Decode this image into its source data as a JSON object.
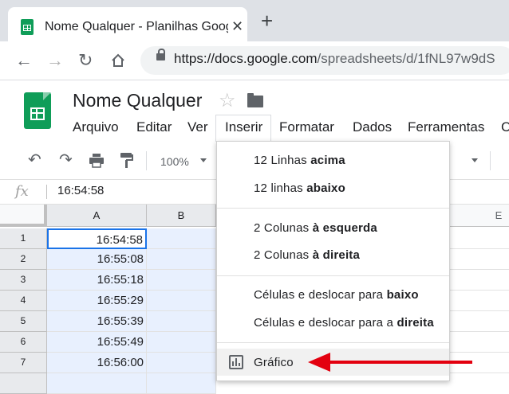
{
  "browser": {
    "tab_title": "Nome Qualquer - Planilhas Goog",
    "tab_close": "✕",
    "new_tab": "+",
    "url_main": "https://docs.google.com",
    "url_rest": "/spreadsheets/d/1fNL97w9dS"
  },
  "doc": {
    "title": "Nome Qualquer",
    "star": "☆"
  },
  "menu": {
    "items": [
      "Arquivo",
      "Editar",
      "Ver",
      "Inserir",
      "Formatar",
      "Dados",
      "Ferramentas",
      "C"
    ]
  },
  "toolbar": {
    "zoom": "100%"
  },
  "formula": {
    "fx": "fx",
    "value": "16:54:58"
  },
  "grid": {
    "columns": [
      "A",
      "B",
      "E"
    ],
    "rows": [
      {
        "num": "1",
        "a": "16:54:58"
      },
      {
        "num": "2",
        "a": "16:55:08"
      },
      {
        "num": "3",
        "a": "16:55:18"
      },
      {
        "num": "4",
        "a": "16:55:29"
      },
      {
        "num": "5",
        "a": "16:55:39"
      },
      {
        "num": "6",
        "a": "16:55:49"
      },
      {
        "num": "7",
        "a": "16:56:00"
      }
    ]
  },
  "insert_menu": {
    "rows_above": {
      "pre": "12 Linhas ",
      "bold": "acima"
    },
    "rows_below": {
      "pre": "12 linhas ",
      "bold": "abaixo"
    },
    "cols_left": {
      "pre": "2 Colunas ",
      "bold": "à esquerda"
    },
    "cols_right": {
      "pre": "2 Colunas ",
      "bold": "à direita"
    },
    "cells_down": {
      "pre": "Células e deslocar para ",
      "bold": "baixo"
    },
    "cells_right": {
      "pre": "Células e deslocar para a ",
      "bold": "direita"
    },
    "chart": "Gráfico"
  },
  "colors": {
    "accent": "#1a73e8",
    "sheets_green": "#0f9d58",
    "arrow_red": "#e3000f"
  }
}
